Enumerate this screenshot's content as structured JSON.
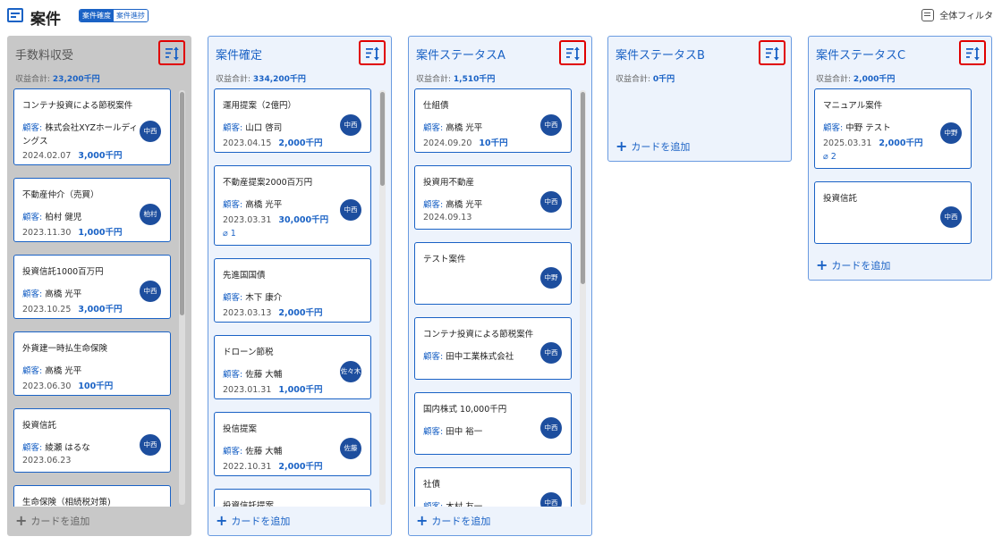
{
  "header": {
    "title": "案件",
    "tabs": [
      "案件確度",
      "案件進捗"
    ],
    "filter_label": "全体フィルタ"
  },
  "colors": {
    "accent": "#1a62c5",
    "avatar": "#1d4e9e",
    "highlight": "#e00000"
  },
  "add_card_label": "カードを追加",
  "sum_label": "収益合計:",
  "customer_label": "顧客:",
  "columns": [
    {
      "title": "手数料収受",
      "sum": "23,200千円",
      "cards": [
        {
          "title": "コンテナ投資による節税案件",
          "customer": "株式会社XYZホールディングス",
          "date": "2024.02.07",
          "amount": "3,000千円",
          "avatar": "中西"
        },
        {
          "title": "不動産仲介（売買）",
          "customer": "柏村 健児",
          "date": "2023.11.30",
          "amount": "1,000千円",
          "avatar": "柏村"
        },
        {
          "title": "投資信託1000百万円",
          "customer": "高橋 光平",
          "date": "2023.10.25",
          "amount": "3,000千円",
          "avatar": "中西"
        },
        {
          "title": "外貨建一時払生命保険",
          "customer": "高橋 光平",
          "date": "2023.06.30",
          "amount": "100千円",
          "avatar": ""
        },
        {
          "title": "投資信託",
          "customer": "綾瀬 はるな",
          "date": "2023.06.23",
          "amount": "",
          "avatar": "中西"
        },
        {
          "title": "生命保険（相続税対策)",
          "customer": "",
          "date": "",
          "amount": "",
          "avatar": ""
        }
      ]
    },
    {
      "title": "案件確定",
      "sum": "334,200千円",
      "cards": [
        {
          "title": "運用提案（2億円）",
          "customer": "山口 啓司",
          "date": "2023.04.15",
          "amount": "2,000千円",
          "avatar": "中西"
        },
        {
          "title": "不動産提案2000百万円",
          "customer": "高橋 光平",
          "date": "2023.03.31",
          "amount": "30,000千円",
          "avatar": "中西",
          "attach": "1"
        },
        {
          "title": "先進国国債",
          "customer": "木下 康介",
          "date": "2023.03.13",
          "amount": "2,000千円",
          "avatar": ""
        },
        {
          "title": "ドローン節税",
          "customer": "佐藤 大輔",
          "date": "2023.01.31",
          "amount": "1,000千円",
          "avatar": "佐々木"
        },
        {
          "title": "投信提案",
          "customer": "佐藤 大輔",
          "date": "2022.10.31",
          "amount": "2,000千円",
          "avatar": "佐藤"
        },
        {
          "title": "投資信託提案",
          "customer": "",
          "date": "",
          "amount": "",
          "avatar": ""
        }
      ]
    },
    {
      "title": "案件ステータスA",
      "sum": "1,510千円",
      "cards": [
        {
          "title": "仕組債",
          "customer": "高橋 光平",
          "date": "2024.09.20",
          "amount": "10千円",
          "avatar": "中西"
        },
        {
          "title": "投資用不動産",
          "customer": "高橋 光平",
          "date": "2024.09.13",
          "amount": "",
          "avatar": "中西"
        },
        {
          "title": "テスト案件",
          "customer": "",
          "date": "",
          "amount": "",
          "avatar": "中野"
        },
        {
          "title": "コンテナ投資による節税案件",
          "customer": "田中工業株式会社",
          "date": "",
          "amount": "",
          "avatar": "中西"
        },
        {
          "title": "国内株式 10,000千円",
          "customer": "田中 裕一",
          "date": "",
          "amount": "",
          "avatar": "中西"
        },
        {
          "title": "社債",
          "customer": "木村 友一",
          "date": "",
          "amount": "",
          "avatar": "中西"
        }
      ]
    },
    {
      "title": "案件ステータスB",
      "sum": "0千円",
      "cards": []
    },
    {
      "title": "案件ステータスC",
      "sum": "2,000千円",
      "cards": [
        {
          "title": "マニュアル案件",
          "customer": "中野 テスト",
          "date": "2025.03.31",
          "amount": "2,000千円",
          "avatar": "中野",
          "attach": "2"
        },
        {
          "title": "投資信託",
          "customer": "",
          "date": "",
          "amount": "",
          "avatar": "中西"
        }
      ]
    }
  ]
}
